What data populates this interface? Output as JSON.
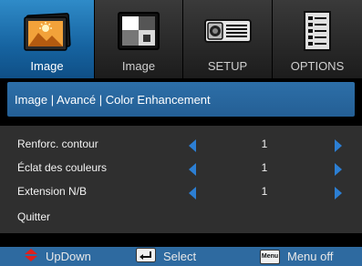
{
  "tabs": [
    {
      "label": "Image",
      "icon": "picture-icon",
      "active": true
    },
    {
      "label": "Image",
      "icon": "display-icon",
      "active": false
    },
    {
      "label": "SETUP",
      "icon": "projector-icon",
      "active": false
    },
    {
      "label": "OPTIONS",
      "icon": "document-icon",
      "active": false
    }
  ],
  "breadcrumb": "Image | Avancé | Color Enhancement",
  "items": [
    {
      "label": "Renforc. contour",
      "value": "1"
    },
    {
      "label": "Éclat des couleurs",
      "value": "1"
    },
    {
      "label": "Extension N/B",
      "value": "1"
    },
    {
      "label": "Quitter"
    }
  ],
  "footer": {
    "updown": "UpDown",
    "select": "Select",
    "menu_icon_text": "Menu",
    "menu_off": "Menu off"
  },
  "colors": {
    "active_tab": "#1a6aab",
    "breadcrumb": "#2a67a0",
    "arrow": "#2c7fd4",
    "footer": "#2e6aa0",
    "updown_arrow": "#e0201c"
  }
}
